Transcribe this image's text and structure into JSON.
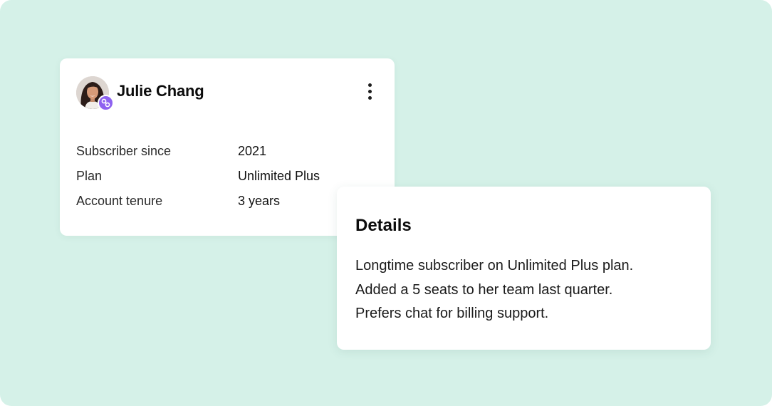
{
  "customer": {
    "name": "Julie Chang",
    "avatar_icon": "user-avatar",
    "badge_icon": "link-icon",
    "badge_color": "#8e62f0",
    "menu_icon": "more-vertical-icon"
  },
  "info_rows": [
    {
      "label": "Subscriber since",
      "value": "2021"
    },
    {
      "label": "Plan",
      "value": "Unlimited Plus"
    },
    {
      "label": "Account tenure",
      "value": "3 years"
    }
  ],
  "details": {
    "title": "Details",
    "lines": [
      "Longtime subscriber on Unlimited Plus plan.",
      "Added a 5 seats to her team last quarter.",
      "Prefers chat for billing support."
    ]
  },
  "colors": {
    "background": "#d5f1e8",
    "card": "#ffffff",
    "accent": "#8e62f0"
  }
}
